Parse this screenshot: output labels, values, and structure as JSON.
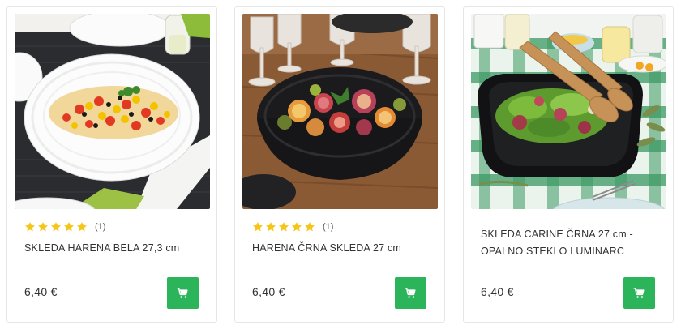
{
  "products": [
    {
      "title_lines": [
        "SKLEDA HARENA BELA 27,3 cm"
      ],
      "price": "6,40 €",
      "rating_count": "(1)",
      "stars": 5,
      "has_rating": true,
      "image_icon": "white-bowl-pasta-salad-photo"
    },
    {
      "title_lines": [
        "HARENA ČRNA SKLEDA 27 cm"
      ],
      "price": "6,40 €",
      "rating_count": "(1)",
      "stars": 5,
      "has_rating": true,
      "image_icon": "black-bowl-fruit-salad-photo"
    },
    {
      "title_lines": [
        "SKLEDA CARINE ČRNA 27 cm -",
        "OPALNO STEKLO LUMINARC"
      ],
      "price": "6,40 €",
      "has_rating": false,
      "image_icon": "black-square-bowl-green-salad-photo"
    }
  ],
  "icons": {
    "cart": "shopping-cart-icon",
    "star": "star-icon"
  },
  "colors": {
    "accent": "#2bb45a",
    "star": "#f5c518"
  }
}
